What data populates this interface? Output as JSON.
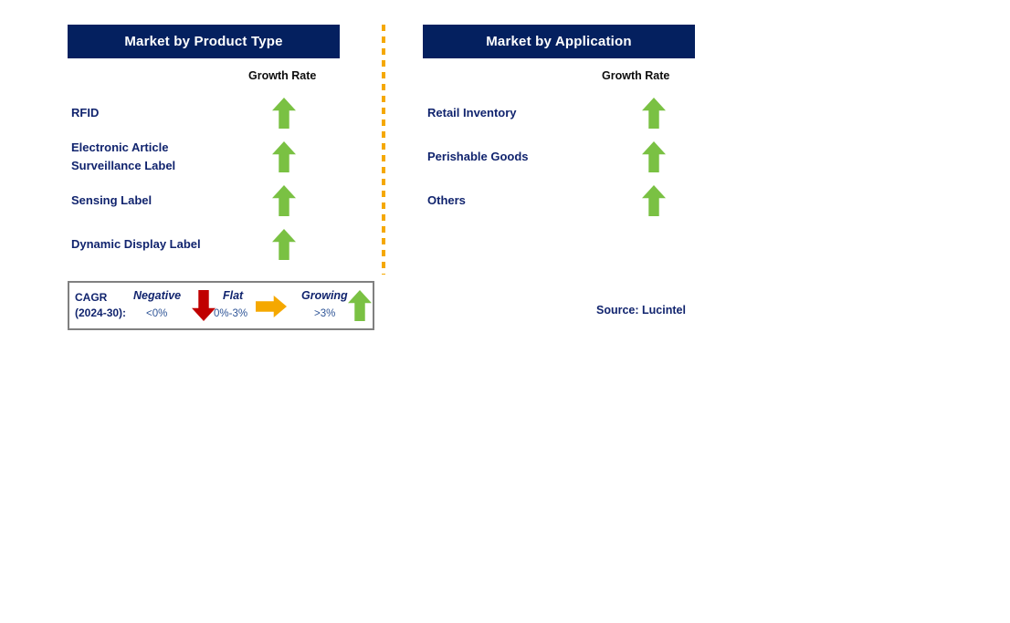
{
  "panels": [
    {
      "id": "product",
      "title": "Market by Product Type",
      "growth_rate_label": "Growth Rate",
      "rows": [
        {
          "label": "RFID",
          "trend": "growing"
        },
        {
          "label": "Electronic Article\nSurveillance Label",
          "trend": "growing"
        },
        {
          "label": "Sensing Label",
          "trend": "growing"
        },
        {
          "label": "Dynamic Display Label",
          "trend": "growing"
        }
      ]
    },
    {
      "id": "application",
      "title": "Market by Application",
      "growth_rate_label": "Growth Rate",
      "rows": [
        {
          "label": "Retail Inventory",
          "trend": "growing"
        },
        {
          "label": "Perishable Goods",
          "trend": "growing"
        },
        {
          "label": "Others",
          "trend": "growing"
        }
      ]
    }
  ],
  "legend": {
    "cagr_label": "CAGR\n(2024-30):",
    "items": [
      {
        "name": "Negative",
        "range": "<0%",
        "icon": "arrow-down-icon",
        "color": "#c00000"
      },
      {
        "name": "Flat",
        "range": "0%-3%",
        "icon": "arrow-right-icon",
        "color": "#f5a800"
      },
      {
        "name": "Growing",
        "range": ">3%",
        "icon": "arrow-up-icon",
        "color": "#7ac143"
      }
    ]
  },
  "source": "Source: Lucintel",
  "colors": {
    "header_navy": "#04205f",
    "text_navy": "#11246e",
    "growing_green": "#7ac143",
    "negative_red": "#c00000",
    "flat_orange": "#f5a800",
    "divider_orange": "#f5a800",
    "legend_border_gray": "#808080"
  },
  "chart_data": {
    "type": "table",
    "title": "Smart Label Market Growth Rate by Segment",
    "legend_position": "bottom-left",
    "grid": false,
    "series": [
      {
        "name": "Market by Product Type",
        "categories": [
          "RFID",
          "Electronic Article Surveillance Label",
          "Sensing Label",
          "Dynamic Display Label"
        ],
        "values": [
          "Growing (>3%)",
          "Growing (>3%)",
          "Growing (>3%)",
          "Growing (>3%)"
        ]
      },
      {
        "name": "Market by Application",
        "categories": [
          "Retail Inventory",
          "Perishable Goods",
          "Others"
        ],
        "values": [
          "Growing (>3%)",
          "Growing (>3%)",
          "Growing (>3%)"
        ]
      }
    ],
    "legend_entries": [
      "Negative <0%",
      "Flat 0%-3%",
      "Growing >3%"
    ]
  }
}
